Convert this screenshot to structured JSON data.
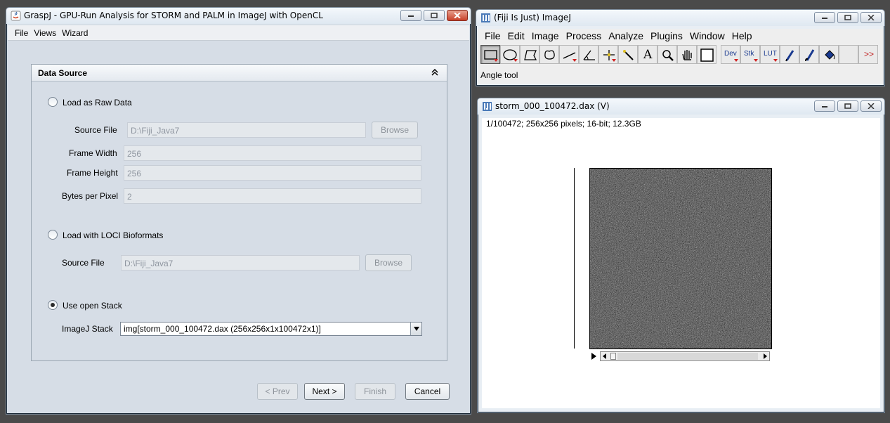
{
  "graspj": {
    "title": "GraspJ - GPU-Run Analysis for STORM and PALM in ImageJ with OpenCL",
    "menu": [
      "File",
      "Views",
      "Wizard"
    ],
    "panel_title": "Data Source",
    "raw": {
      "radio_label": "Load as Raw Data",
      "source_label": "Source File",
      "source_value": "D:\\Fiji_Java7",
      "browse": "Browse",
      "frame_width_label": "Frame Width",
      "frame_width_value": "256",
      "frame_height_label": "Frame Height",
      "frame_height_value": "256",
      "bpp_label": "Bytes per Pixel",
      "bpp_value": "2"
    },
    "loci": {
      "radio_label": "Load with LOCI Bioformats",
      "source_label": "Source File",
      "source_value": "D:\\Fiji_Java7",
      "browse": "Browse"
    },
    "stack": {
      "radio_label": "Use open Stack",
      "label": "ImageJ Stack",
      "selected": "img[storm_000_100472.dax (256x256x1x100472x1)]"
    },
    "buttons": {
      "prev": "< Prev",
      "next": "Next >",
      "finish": "Finish",
      "cancel": "Cancel"
    }
  },
  "imagej": {
    "title": "(Fiji Is Just) ImageJ",
    "menu": [
      "File",
      "Edit",
      "Image",
      "Process",
      "Analyze",
      "Plugins",
      "Window",
      "Help"
    ],
    "tools": [
      "rectangle-tool",
      "oval-tool",
      "polygon-tool",
      "freehand-tool",
      "line-tool",
      "angle-tool",
      "point-tool",
      "wand-tool",
      "text-tool",
      "magnifier-tool",
      "hand-tool",
      "color-picker-tool",
      "dev-menu",
      "stk-menu",
      "lut-menu",
      "pencil-tool",
      "brush-tool",
      "flood-fill-tool",
      "blank-slot",
      "more-tools"
    ],
    "tool_labels": {
      "dev": "Dev",
      "stk": "Stk",
      "lut": "LUT",
      "more": ">>",
      "text": "A"
    },
    "status": "Angle tool"
  },
  "stack_window": {
    "title": "storm_000_100472.dax (V)",
    "info": "1/100472; 256x256 pixels; 16-bit; 12.3GB"
  }
}
